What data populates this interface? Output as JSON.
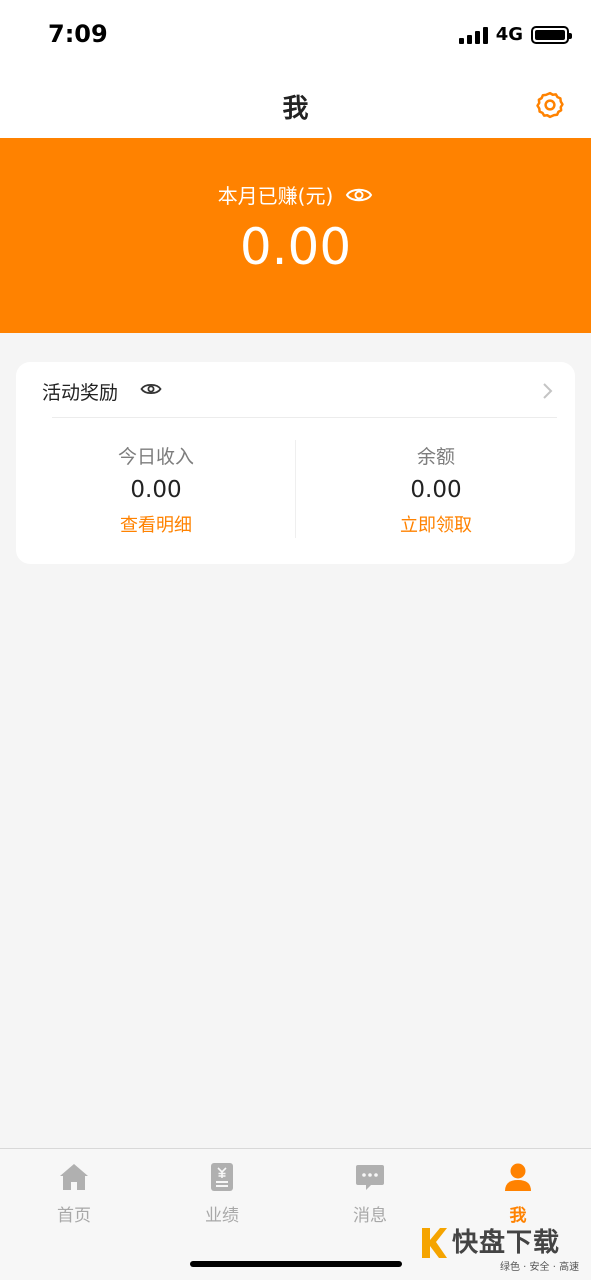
{
  "status_bar": {
    "time": "7:09",
    "network": "4G"
  },
  "header": {
    "title": "我",
    "settings_icon": "gear-icon"
  },
  "banner": {
    "label": "本月已赚(元)",
    "amount": "0.00",
    "visibility_icon": "eye-icon",
    "color": "#ff8200"
  },
  "rewards_card": {
    "title": "活动奖励",
    "visibility_icon": "eye-icon",
    "chevron_icon": "chevron-right-icon",
    "today_income": {
      "label": "今日收入",
      "value": "0.00",
      "link": "查看明细"
    },
    "balance": {
      "label": "余额",
      "value": "0.00",
      "link": "立即领取"
    }
  },
  "tab_bar": {
    "tabs": [
      {
        "label": "首页",
        "icon": "home-icon",
        "active": false
      },
      {
        "label": "业绩",
        "icon": "document-yen-icon",
        "active": false
      },
      {
        "label": "消息",
        "icon": "chat-icon",
        "active": false
      },
      {
        "label": "我",
        "icon": "user-icon",
        "active": true
      }
    ],
    "active_color": "#ff8200",
    "inactive_color": "#a8a8a8"
  },
  "watermark": {
    "text": "快盘下载",
    "subtitle": "绿色 · 安全 · 高速"
  }
}
